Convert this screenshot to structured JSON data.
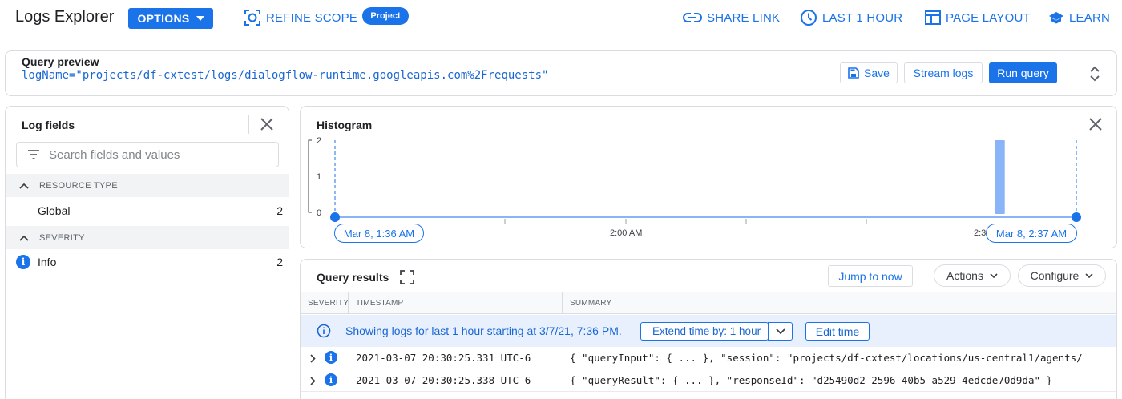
{
  "app": {
    "title": "Logs Explorer"
  },
  "header": {
    "options_label": "OPTIONS",
    "refine_scope_label": "REFINE SCOPE",
    "scope_badge": "Project",
    "share_link_label": "SHARE LINK",
    "time_range_label": "LAST 1 HOUR",
    "page_layout_label": "PAGE LAYOUT",
    "learn_label": "LEARN"
  },
  "query": {
    "label": "Query preview",
    "text": "logName=\"projects/df-cxtest/logs/dialogflow-runtime.googleapis.com%2Frequests\"",
    "save_label": "Save",
    "stream_label": "Stream logs",
    "run_label": "Run query"
  },
  "log_fields": {
    "title": "Log fields",
    "search_placeholder": "Search fields and values",
    "sections": [
      {
        "heading": "RESOURCE TYPE",
        "items": [
          {
            "name": "Global",
            "count": "2"
          }
        ]
      },
      {
        "heading": "SEVERITY",
        "items": [
          {
            "name": "Info",
            "count": "2",
            "icon": "info-icon"
          }
        ]
      }
    ]
  },
  "histogram": {
    "title": "Histogram",
    "start_label": "Mar 8, 1:36 AM",
    "end_label": "Mar 8, 2:37 AM",
    "mid_label": "2:00 AM",
    "clipped_label": "2:3"
  },
  "chart_data": {
    "type": "bar",
    "y_ticks": [
      "0",
      "1",
      "2"
    ],
    "ylim": [
      0,
      2
    ],
    "bars": [
      {
        "position_fraction": 0.897,
        "value": 2
      }
    ],
    "accent": "#1a73e8",
    "bar_color": "#8ab4f8"
  },
  "results": {
    "title": "Query results",
    "jump_label": "Jump to now",
    "actions_label": "Actions",
    "configure_label": "Configure",
    "columns": {
      "severity": "SEVERITY",
      "timestamp": "TIMESTAMP",
      "summary": "SUMMARY"
    },
    "banner_text": "Showing logs for last 1 hour starting at 3/7/21, 7:36 PM.",
    "extend_label": "Extend time by: 1 hour",
    "edit_time_label": "Edit time",
    "rows": [
      {
        "timestamp": "2021-03-07 20:30:25.331 UTC-6",
        "summary": "{ \"queryInput\": { ... }, \"session\": \"projects/df-cxtest/locations/us-central1/agents/…"
      },
      {
        "timestamp": "2021-03-07 20:30:25.338 UTC-6",
        "summary": "{ \"queryResult\": { ... }, \"responseId\": \"d25490d2-2596-40b5-a529-4edcde70d9da\" }"
      }
    ]
  }
}
